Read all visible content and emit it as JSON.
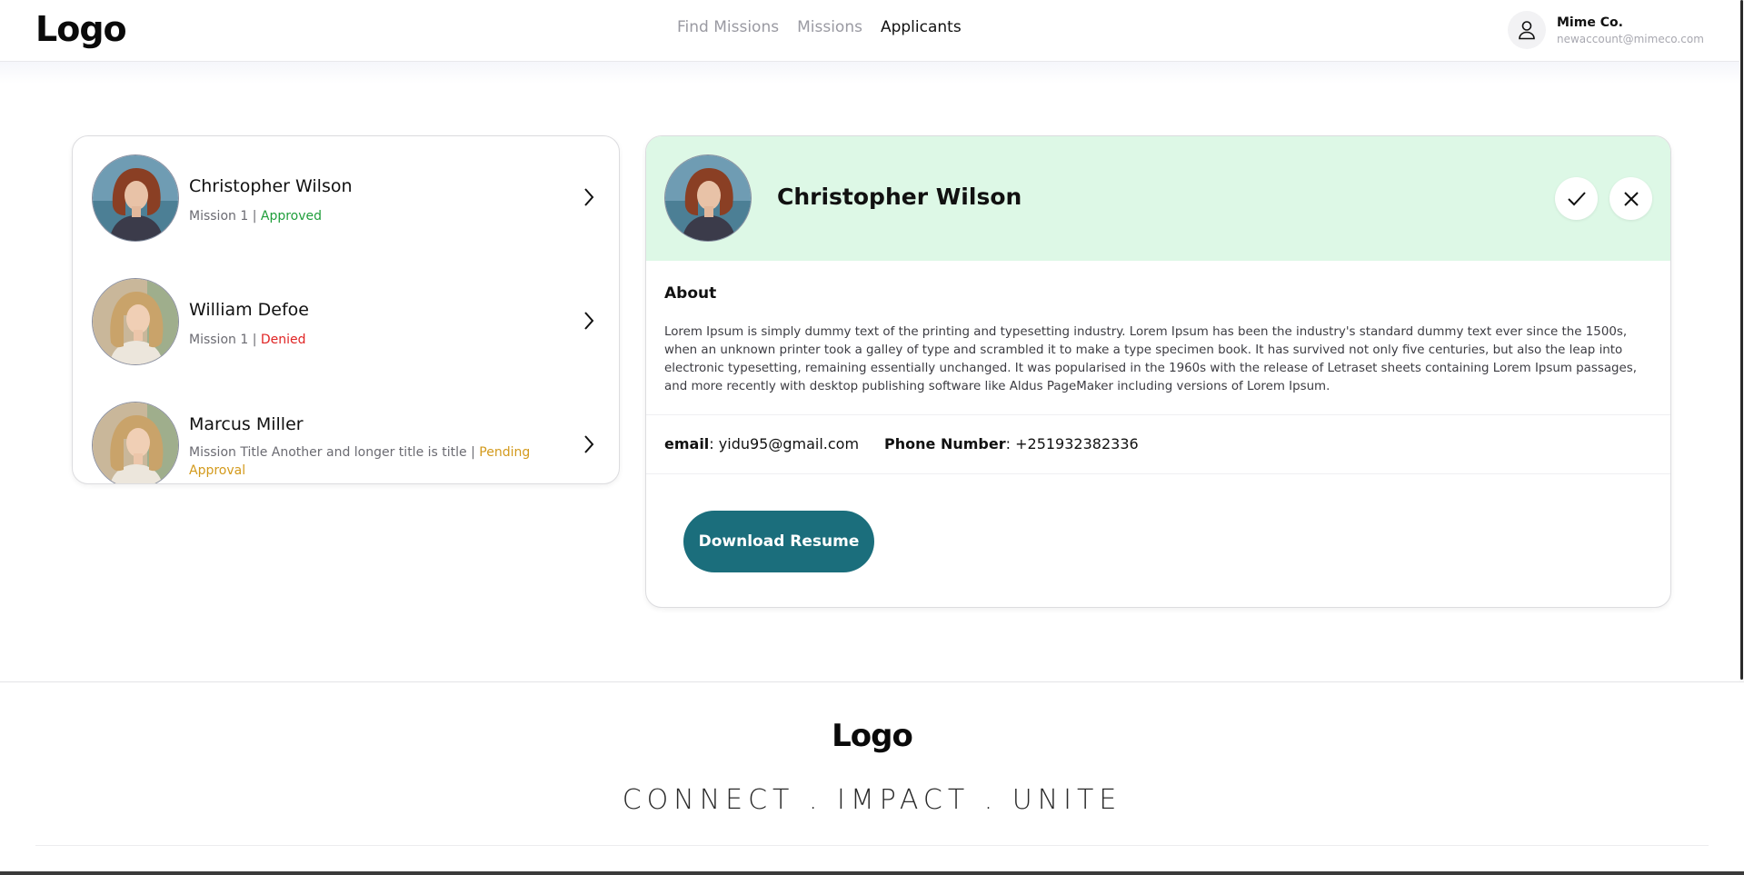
{
  "header": {
    "logo": "Logo",
    "nav": [
      {
        "label": "Find Missions",
        "active": false
      },
      {
        "label": "Missions",
        "active": false
      },
      {
        "label": "Applicants",
        "active": true
      }
    ],
    "account": {
      "name": "Mime Co.",
      "email": "newaccount@mimeco.com",
      "icon": "user-icon"
    }
  },
  "applicants": [
    {
      "name": "Christopher Wilson",
      "mission": "Mission 1",
      "separator": " | ",
      "status": "Approved",
      "status_color": "#1f9e3b"
    },
    {
      "name": "William Defoe",
      "mission": "Mission 1",
      "separator": " | ",
      "status": "Denied",
      "status_color": "#e02424"
    },
    {
      "name": "Marcus Miller",
      "mission": "Mission Title Another and longer title is title",
      "separator": " | ",
      "status": "Pending Approval",
      "status_color": "#d39a1c"
    }
  ],
  "detail": {
    "name": "Christopher Wilson",
    "header_bg": "#ddf8e6",
    "about_label": "About",
    "about_text": "Lorem Ipsum is simply dummy text of the printing and typesetting industry. Lorem Ipsum has been the industry's standard dummy text ever since the 1500s, when an unknown printer took a galley of type and scrambled it to make a type specimen book. It has survived not only five centuries, but also the leap into electronic typesetting, remaining essentially unchanged. It was popularised in the 1960s with the release of Letraset sheets containing Lorem Ipsum passages, and more recently with desktop publishing software like Aldus PageMaker including versions of Lorem Ipsum.",
    "email_label": "email",
    "email": "yidu95@gmail.com",
    "phone_label": "Phone Number",
    "phone": "+251932382336",
    "download_label": "Download Resume",
    "accent": "#1b6e7c"
  },
  "footer": {
    "logo": "Logo",
    "tagline": "CONNECT . IMPACT . UNITE"
  }
}
